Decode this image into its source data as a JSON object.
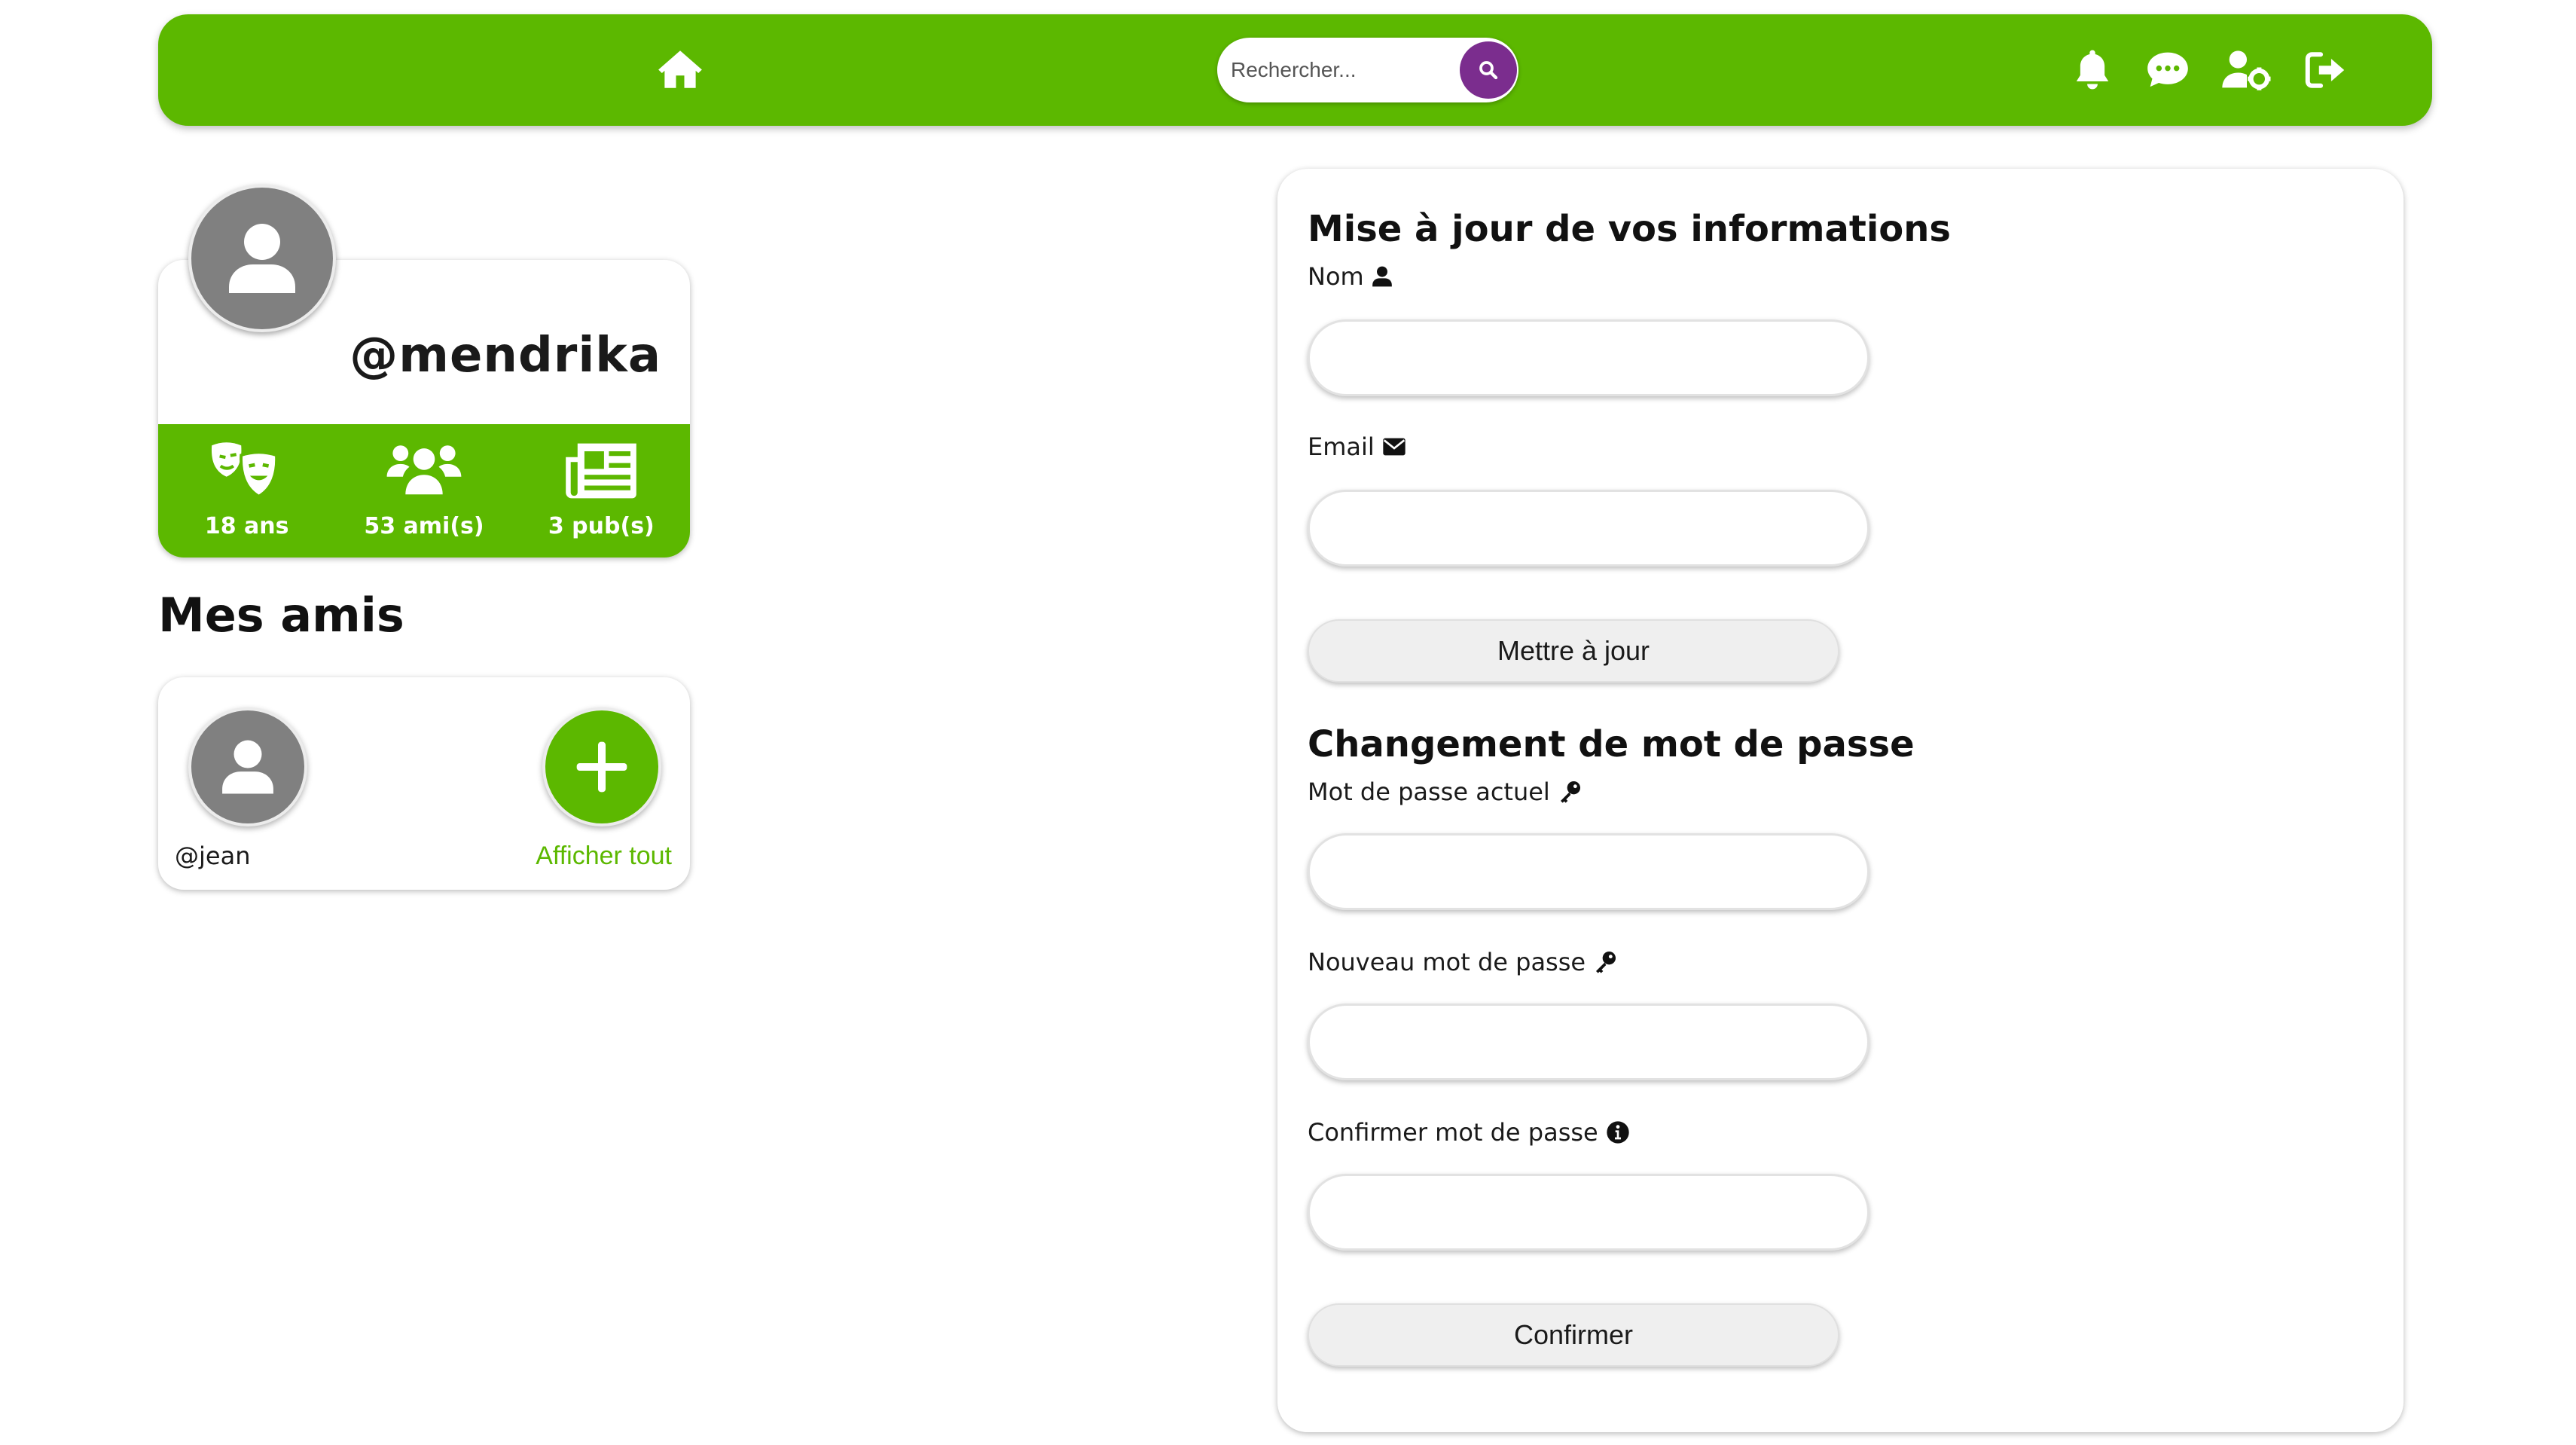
{
  "colors": {
    "brand_green": "#5cb800",
    "search_button": "#7b2d8e",
    "avatar_gray": "#808080"
  },
  "navbar": {
    "home_icon": "home-icon",
    "search": {
      "placeholder": "Rechercher...",
      "icon": "search-icon"
    },
    "right_icons": [
      "bell-icon",
      "chat-icon",
      "user-settings-icon",
      "logout-icon"
    ]
  },
  "profile": {
    "username": "@mendrika",
    "stats": [
      {
        "icon": "theater-masks-icon",
        "label": "18 ans"
      },
      {
        "icon": "users-icon",
        "label": "53 ami(s)"
      },
      {
        "icon": "newspaper-icon",
        "label": "3 pub(s)"
      }
    ]
  },
  "friends": {
    "title": "Mes amis",
    "items": [
      {
        "name": "@jean"
      }
    ],
    "show_all": "Afficher tout"
  },
  "settings": {
    "update_title": "Mise à jour de vos informations",
    "name_label": "Nom",
    "email_label": "Email",
    "name_value": "",
    "email_value": "",
    "update_button": "Mettre à jour",
    "password_title": "Changement de mot de passe",
    "current_password_label": "Mot de passe actuel",
    "new_password_label": "Nouveau mot de passe",
    "confirm_password_label": "Confirmer mot de passe",
    "confirm_button": "Confirmer"
  }
}
